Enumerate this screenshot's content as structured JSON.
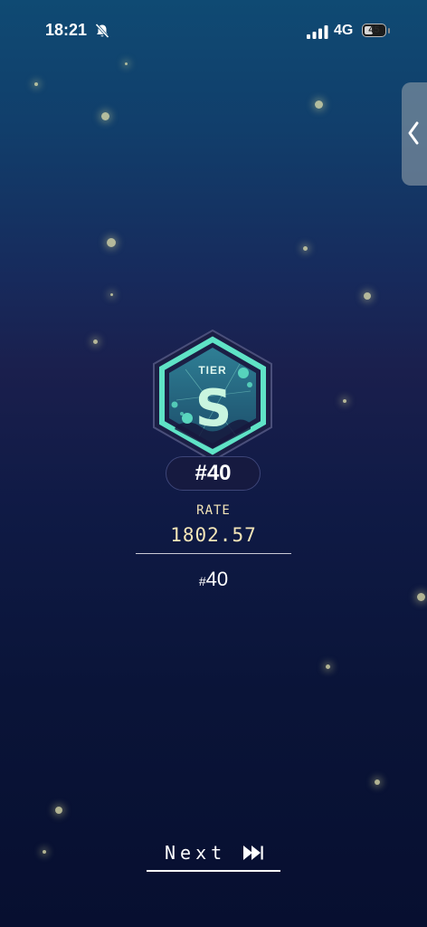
{
  "status_bar": {
    "time": "18:21",
    "network": "4G",
    "battery_level": "45",
    "icons": [
      "bell-slash-icon",
      "signal-bars-icon",
      "battery-icon"
    ]
  },
  "side_handle": {
    "icon": "chevron-left-icon"
  },
  "badge": {
    "tier_word": "TIER",
    "tier_letter": "S",
    "icon": "tier-badge-icon"
  },
  "rank_pill": "#40",
  "rate": {
    "label": "RATE",
    "value": "1802.57"
  },
  "rank_secondary": {
    "hash": "#",
    "number": "40"
  },
  "next_button": {
    "label": "Next",
    "icon": "fast-forward-icon"
  },
  "colors": {
    "accent_teal": "#5fe3c6",
    "rate_text": "#f5e6b8",
    "background_top": "#0f4a73",
    "background_bottom": "#070f30"
  }
}
